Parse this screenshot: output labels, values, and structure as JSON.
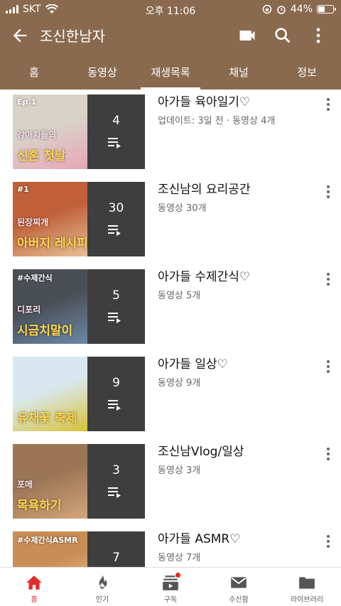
{
  "status": {
    "carrier": "SKT",
    "time": "오후 11:06",
    "battery": "44%",
    "battery_level": 0.44
  },
  "header": {
    "title": "조신한남자"
  },
  "tabs": [
    {
      "label": "홈"
    },
    {
      "label": "동영상"
    },
    {
      "label": "재생목록"
    },
    {
      "label": "채널"
    },
    {
      "label": "정보"
    }
  ],
  "playlists": [
    {
      "title": "아가들 육아일기♡",
      "meta": "업데이트: 3일 전 · 동영상 4개",
      "count": "4",
      "thumb_tag": "Ep.1",
      "thumb_text": "강아지들의",
      "thumb_text2": "신혼 첫날",
      "colors": [
        "#d9d2c8",
        "#e8a6b8"
      ]
    },
    {
      "title": "조신남의 요리공간",
      "meta": "동영상 30개",
      "count": "30",
      "thumb_tag": "#1",
      "thumb_text": "된장찌개",
      "thumb_text2": "아버지 레시피",
      "colors": [
        "#c0603a",
        "#e7c095"
      ]
    },
    {
      "title": "아가들 수제간식♡",
      "meta": "동영상 5개",
      "count": "5",
      "thumb_tag": "#수제간식",
      "thumb_text": "디포리",
      "thumb_text2": "시금치말이",
      "colors": [
        "#4a4e55",
        "#6b8aa8"
      ]
    },
    {
      "title": "아가들 일상♡",
      "meta": "동영상 9개",
      "count": "9",
      "thumb_tag": "",
      "thumb_text": "",
      "thumb_text2": "유채꽃 축제",
      "colors": [
        "#d9e8f0",
        "#d8c23a"
      ]
    },
    {
      "title": "조신남Vlog/일상",
      "meta": "동영상 3개",
      "count": "3",
      "thumb_tag": "",
      "thumb_text": "포메",
      "thumb_text2": "목욕하기",
      "colors": [
        "#9b7656",
        "#d3a57b"
      ]
    },
    {
      "title": "아가들 ASMR♡",
      "meta": "동영상 7개",
      "count": "7",
      "thumb_tag": "#수제간식ASMR",
      "thumb_text": "",
      "thumb_text2": "",
      "colors": [
        "#c98e55",
        "#f2d1a5"
      ]
    }
  ],
  "bottom_nav": [
    {
      "label": "홈",
      "icon": "home-icon"
    },
    {
      "label": "인기",
      "icon": "flame-icon"
    },
    {
      "label": "구독",
      "icon": "subscriptions-icon"
    },
    {
      "label": "수신함",
      "icon": "inbox-icon"
    },
    {
      "label": "라이브러리",
      "icon": "library-icon"
    }
  ],
  "colors": {
    "brand": "#8a6a4e",
    "accent": "#e52b2b"
  }
}
